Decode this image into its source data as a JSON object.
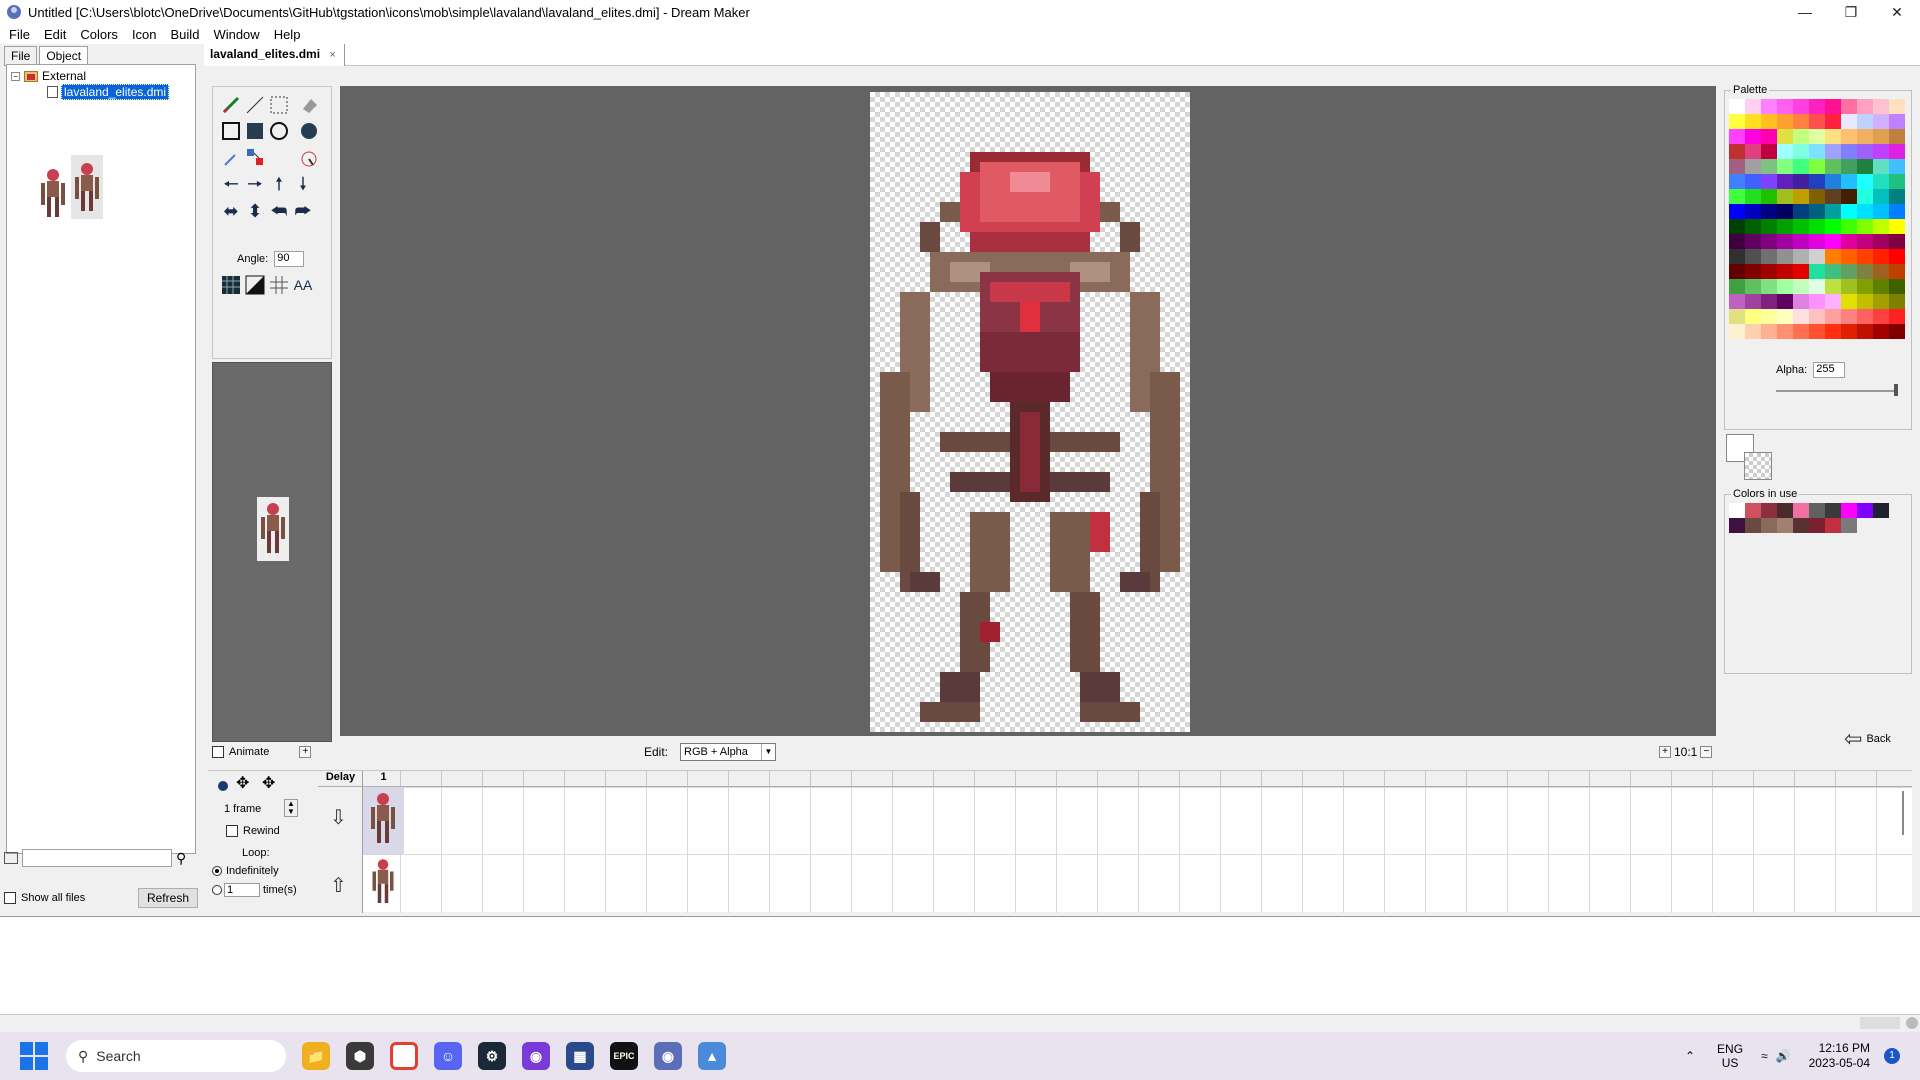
{
  "window": {
    "title": "Untitled [C:\\Users\\blotc\\OneDrive\\Documents\\GitHub\\tgstation\\icons\\mob\\simple\\lavaland\\lavaland_elites.dmi] - Dream Maker",
    "minimize": "—",
    "maximize": "❐",
    "close": "✕"
  },
  "menu": [
    "File",
    "Edit",
    "Colors",
    "Icon",
    "Build",
    "Window",
    "Help"
  ],
  "left_panel": {
    "tabs": [
      "File",
      "Object"
    ],
    "tree": {
      "root": "External",
      "root_expander": "−",
      "child": "lavaland_elites.dmi"
    },
    "show_all_files": "Show all files",
    "refresh": "Refresh"
  },
  "document": {
    "tab": "lavaland_elites.dmi",
    "tab_close": "×"
  },
  "toolbox": {
    "angle_label": "Angle:",
    "angle_value": "90",
    "aa_label": "AA",
    "animate_label": "Animate"
  },
  "edit": {
    "label": "Edit:",
    "mode": "RGB + Alpha",
    "zoom": "10:1"
  },
  "palette": {
    "title": "Palette",
    "alpha_label": "Alpha:",
    "alpha_value": "255",
    "colors_in_use_title": "Colors in use",
    "back": "Back",
    "swatches": [
      "#ffffff",
      "#ffd0f0",
      "#ff80ff",
      "#ff60f0",
      "#ff40e0",
      "#ff20c0",
      "#ff1090",
      "#ff70a0",
      "#ffa0c0",
      "#ffc0d0",
      "#ffe0c0",
      "#ffff40",
      "#ffe020",
      "#ffc020",
      "#ffa030",
      "#ff8040",
      "#ff5050",
      "#ff2040",
      "#e8e8ff",
      "#c0d0ff",
      "#d0b0ff",
      "#c080ff",
      "#ff40ff",
      "#ff00e0",
      "#ff00b0",
      "#e0e040",
      "#c0ff80",
      "#e0ffa0",
      "#ffe080",
      "#ffc070",
      "#f0b060",
      "#e0a050",
      "#c08040",
      "#c03030",
      "#e04080",
      "#c00040",
      "#a0ffff",
      "#80ffe0",
      "#80e0ff",
      "#a0a0ff",
      "#8080ff",
      "#a060ff",
      "#c040ff",
      "#e020e0",
      "#a06080",
      "#a0a0a0",
      "#80c080",
      "#80ff80",
      "#40ff80",
      "#80ff40",
      "#60c060",
      "#40a060",
      "#208040",
      "#60e0c0",
      "#40c0ff",
      "#4080ff",
      "#4060ff",
      "#8040ff",
      "#6020c0",
      "#4020a0",
      "#2040c0",
      "#2080e0",
      "#20c0ff",
      "#20ffff",
      "#20e0c0",
      "#20c080",
      "#40ff40",
      "#20e020",
      "#20c000",
      "#a0c020",
      "#c0a000",
      "#806000",
      "#604020",
      "#402000",
      "#20ffe0",
      "#00c0c0",
      "#008080",
      "#0000ff",
      "#0000c0",
      "#000080",
      "#000060",
      "#004080",
      "#006080",
      "#00a0a0",
      "#00ffff",
      "#00e0ff",
      "#00c0ff",
      "#0080ff",
      "#004000",
      "#006000",
      "#008000",
      "#00a000",
      "#00c000",
      "#00e000",
      "#00ff00",
      "#40ff00",
      "#80ff00",
      "#c0ff00",
      "#ffff00",
      "#400040",
      "#600060",
      "#800080",
      "#a000a0",
      "#c000c0",
      "#e000e0",
      "#ff00ff",
      "#e000a0",
      "#c00080",
      "#a00060",
      "#800040",
      "#303030",
      "#505050",
      "#707070",
      "#909090",
      "#b0b0b0",
      "#d0d0d0",
      "#ff8000",
      "#ff6000",
      "#ff4000",
      "#ff2000",
      "#ff0000",
      "#600000",
      "#800000",
      "#a00000",
      "#c00000",
      "#e00000",
      "#20e0a0",
      "#40c080",
      "#60a060",
      "#808040",
      "#a06020",
      "#c04000",
      "#40a040",
      "#60c060",
      "#80e080",
      "#a0ffa0",
      "#c0ffc0",
      "#e0ffe0",
      "#c0e040",
      "#a0c020",
      "#80a000",
      "#608000",
      "#406000",
      "#c060c0",
      "#a040a0",
      "#802080",
      "#600060",
      "#e080e0",
      "#ff90ff",
      "#ffb0ff",
      "#e0e000",
      "#c0c000",
      "#a0a000",
      "#808000",
      "#e0e080",
      "#ffff80",
      "#ffffa0",
      "#ffffc0",
      "#ffe0e0",
      "#ffc0c0",
      "#ffa0a0",
      "#ff8080",
      "#ff6060",
      "#ff4040",
      "#ff2020",
      "#fff0d0",
      "#ffd0b0",
      "#ffb090",
      "#ff9070",
      "#ff7050",
      "#ff5030",
      "#ff3010",
      "#e02000",
      "#c01000",
      "#a00000",
      "#800000"
    ],
    "colors_in_use": [
      "#ffffff",
      "#d05060",
      "#8a3040",
      "#4a2a2a",
      "#f070a0",
      "#606060",
      "#3a3a3a",
      "#ff00ff",
      "#8000ff",
      "#202030",
      "#401040",
      "#6a4a40",
      "#8a6a5a",
      "#a08070",
      "#5a3030",
      "#7a2030",
      "#c03040",
      "#7a7a7a",
      "#f0f0f0"
    ]
  },
  "timeline": {
    "frames_label": "1 frame",
    "rewind": "Rewind",
    "loop_label": "Loop:",
    "indefinitely": "Indefinitely",
    "times_value": "1",
    "times_label": "time(s)",
    "delay_header": "Delay",
    "frame_1": "1"
  },
  "taskbar": {
    "search_placeholder": "Search",
    "language_top": "ENG",
    "language_bottom": "US",
    "time": "12:16 PM",
    "date": "2023-05-04",
    "notification_count": "1",
    "epic_label": "EPIC"
  }
}
